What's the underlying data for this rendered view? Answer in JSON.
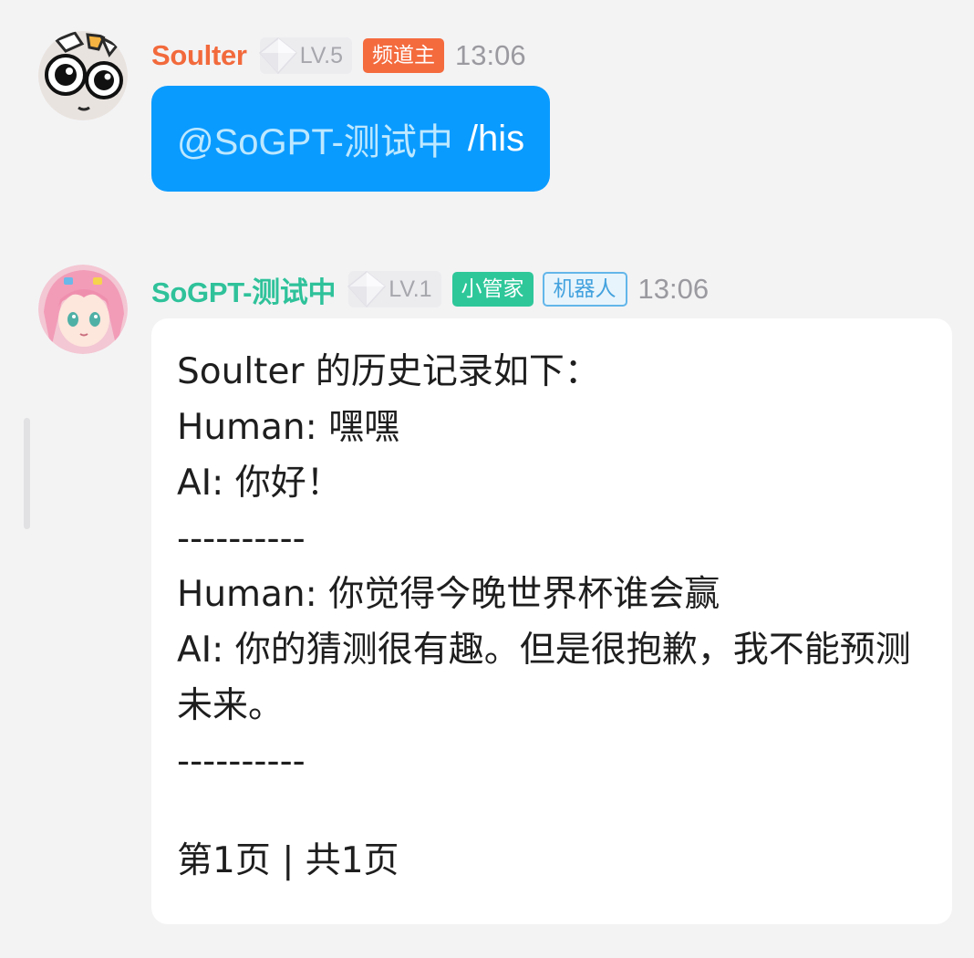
{
  "messages": [
    {
      "username": "Soulter",
      "level": "LV.5",
      "badges": [
        "频道主"
      ],
      "time": "13:06",
      "mention": "@SoGPT-测试中",
      "command": "/his",
      "avatar": "cartoon-eyes-avatar"
    },
    {
      "username": "SoGPT-测试中",
      "level": "LV.1",
      "badges": [
        "小管家",
        "机器人"
      ],
      "time": "13:06",
      "avatar": "pink-hair-anime-avatar",
      "lines": [
        "Soulter 的历史记录如下：",
        "Human: 嘿嘿",
        "AI: 你好！",
        "----------",
        "Human: 你觉得今晚世界杯谁会赢",
        "AI: 你的猜测很有趣。但是很抱歉，我不能预测未来。",
        "----------"
      ],
      "pagination": "第1页 | 共1页"
    }
  ],
  "colors": {
    "background": "#f3f3f4",
    "owner_name": "#f26a3c",
    "bot_name": "#2fc29a",
    "owner_badge": "#f46b3e",
    "keeper_badge": "#2ec79a",
    "bot_badge_border": "#62b6ea",
    "user_bubble": "#0a9bff",
    "bot_bubble": "#ffffff"
  }
}
